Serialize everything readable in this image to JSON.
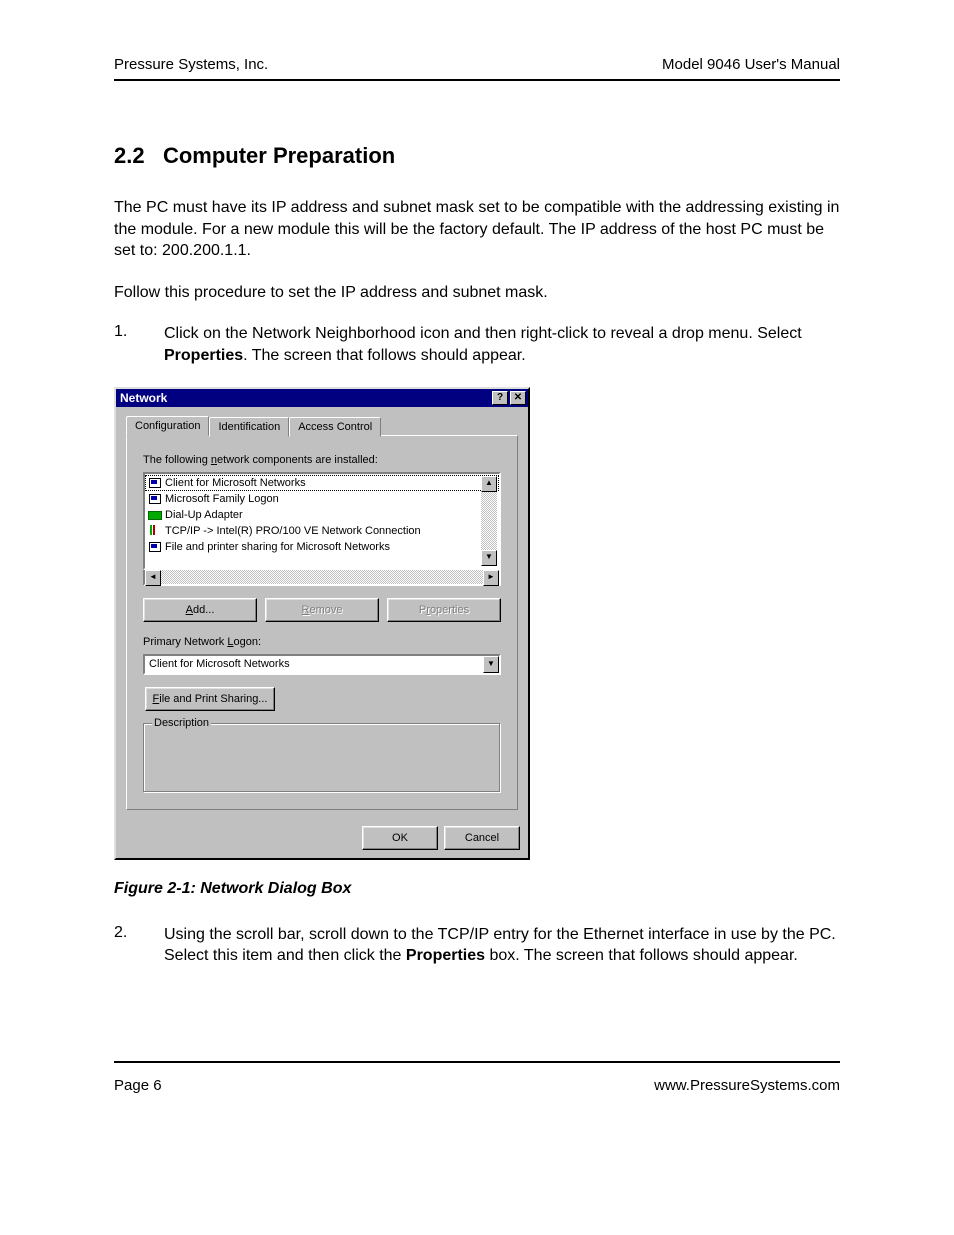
{
  "header": {
    "left": "Pressure Systems, Inc.",
    "right": "Model 9046 User's Manual"
  },
  "section": {
    "number": "2.2",
    "title": "Computer Preparation"
  },
  "paragraphs": {
    "p1": "The PC must have its IP address and subnet mask set to be compatible with the addressing existing in the module. For a new module this will be the factory default. The IP address of the host PC must be set to: 200.200.1.1.",
    "p2": "Follow this procedure to set the IP address and subnet mask."
  },
  "steps": {
    "s1": {
      "num": "1.",
      "text_a": "Click on the Network Neighborhood icon and then right-click to reveal a drop menu. Select ",
      "bold": "Properties",
      "text_b": ". The screen that follows should appear."
    },
    "s2": {
      "num": "2.",
      "text_a": "Using the scroll bar, scroll down to the TCP/IP entry for the Ethernet interface in use by the PC. Select this item and then click the ",
      "bold": "Properties",
      "text_b": " box. The screen that follows should appear."
    }
  },
  "dialog": {
    "title": "Network",
    "help_glyph": "?",
    "close_glyph": "✕",
    "tabs": {
      "t1": "Configuration",
      "t2": "Identification",
      "t3": "Access Control"
    },
    "label_components_a": "The following ",
    "label_components_u": "n",
    "label_components_b": "etwork components are installed:",
    "list": [
      "Client for Microsoft Networks",
      "Microsoft Family Logon",
      "Dial-Up Adapter",
      "TCP/IP -> Intel(R) PRO/100 VE Network Connection",
      "File and printer sharing for Microsoft Networks"
    ],
    "buttons": {
      "add_u": "A",
      "add_rest": "dd...",
      "remove_u": "R",
      "remove_rest": "emove",
      "properties_u": "r",
      "properties_pre": "P",
      "properties_post": "operties"
    },
    "primary_logon_label_a": "Primary Network ",
    "primary_logon_label_u": "L",
    "primary_logon_label_b": "ogon:",
    "primary_logon_value": "Client for Microsoft Networks",
    "share_btn_u": "F",
    "share_btn_rest": "ile and Print Sharing...",
    "description_label": "Description",
    "ok": "OK",
    "cancel": "Cancel",
    "arrows": {
      "up": "▲",
      "down": "▼",
      "left": "◄",
      "right": "►"
    }
  },
  "figure_caption": "Figure 2-1:  Network Dialog Box",
  "footer": {
    "left": "Page 6",
    "right": "www.PressureSystems.com"
  }
}
